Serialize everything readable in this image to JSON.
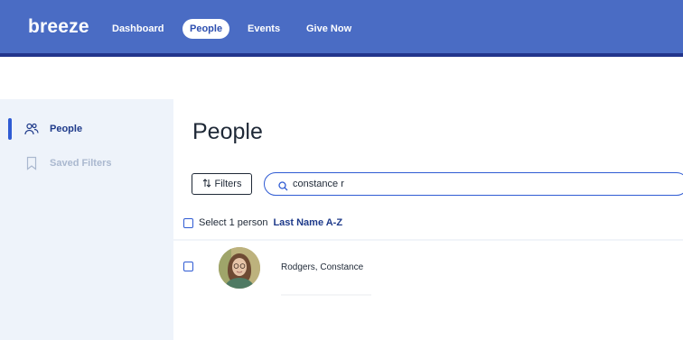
{
  "header": {
    "logo": "breeze",
    "nav": [
      {
        "label": "Dashboard",
        "active": false
      },
      {
        "label": "People",
        "active": true
      },
      {
        "label": "Events",
        "active": false
      },
      {
        "label": "Give Now",
        "active": false
      }
    ]
  },
  "sidebar": {
    "items": [
      {
        "label": "People",
        "icon": "people-icon",
        "active": true
      },
      {
        "label": "Saved Filters",
        "icon": "bookmark-icon",
        "active": false
      }
    ]
  },
  "main": {
    "title": "People",
    "filters_label": "Filters",
    "search": {
      "value": "constance r",
      "placeholder": ""
    },
    "select_label": "Select 1 person",
    "sort_label": "Last Name A-Z",
    "results": [
      {
        "name": "Rodgers, Constance"
      }
    ]
  },
  "colors": {
    "nav_bg": "#4a6cc4",
    "accent": "#2f5bd3",
    "sidebar_bg": "#eef3fa"
  }
}
